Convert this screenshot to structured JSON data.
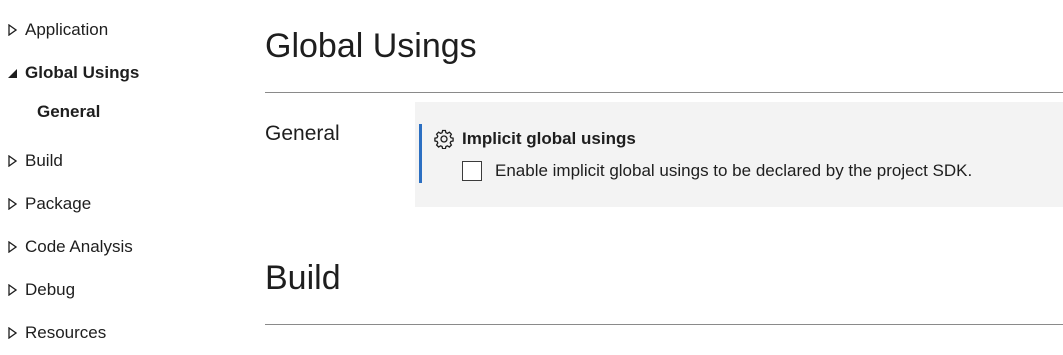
{
  "sidebar": {
    "items": [
      {
        "label": "Application",
        "state": "collapsed"
      },
      {
        "label": "Global Usings",
        "state": "expanded",
        "selected": true
      },
      {
        "label": "General",
        "state": "child"
      },
      {
        "label": "Build",
        "state": "collapsed"
      },
      {
        "label": "Package",
        "state": "collapsed"
      },
      {
        "label": "Code Analysis",
        "state": "collapsed"
      },
      {
        "label": "Debug",
        "state": "collapsed"
      },
      {
        "label": "Resources",
        "state": "collapsed"
      }
    ]
  },
  "main": {
    "sections": [
      {
        "title": "Global Usings",
        "groups": [
          {
            "label": "General",
            "setting": {
              "icon": "gear-icon",
              "title": "Implicit global usings",
              "checkbox_label": "Enable implicit global usings to be declared by the project SDK.",
              "checked": false
            }
          }
        ]
      },
      {
        "title": "Build"
      }
    ]
  },
  "colors": {
    "accent": "#2b6fc2",
    "card_background": "#f3f3f3",
    "divider": "#8a8a8a"
  }
}
